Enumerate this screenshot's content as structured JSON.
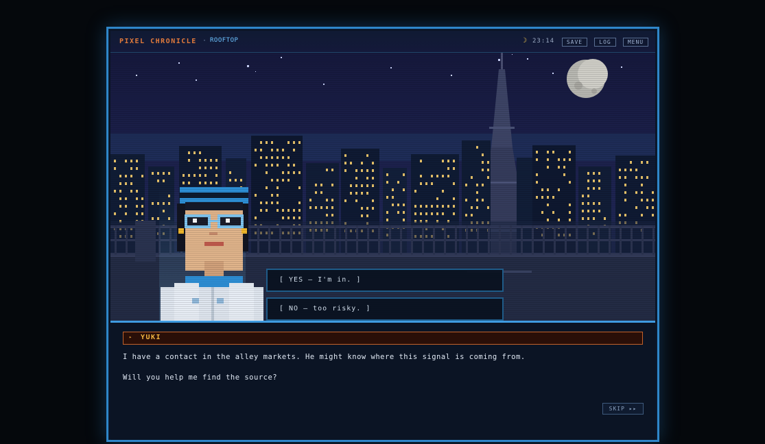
{
  "hud": {
    "title": "PIXEL CHRONICLE",
    "separator": "·",
    "location": "ROOFTOP",
    "time_icon": "crescent-moon-icon",
    "time": "23:14",
    "buttons": {
      "save": "SAVE",
      "log": "LOG",
      "menu": "MENU"
    }
  },
  "scene": {
    "setting": "night city rooftop with tower and full moon",
    "character": "Yuki"
  },
  "choices": [
    {
      "label": "[ YES — I'm in. ]"
    },
    {
      "label": "[ NO — too risky. ]"
    }
  ],
  "dialog": {
    "speaker_marker": "▸",
    "speaker": "YUKI",
    "lines": [
      "I have a contact in the alley markets. He might know where this signal is coming from.",
      "Will you help me find the source?"
    ],
    "skip": "SKIP ▸▸"
  },
  "colors": {
    "frame": "#2f86c9",
    "accent_orange": "#e07a3c",
    "name_gold": "#f2b540",
    "location_blue": "#6cc2ff",
    "window_light": "#e8c36a"
  }
}
